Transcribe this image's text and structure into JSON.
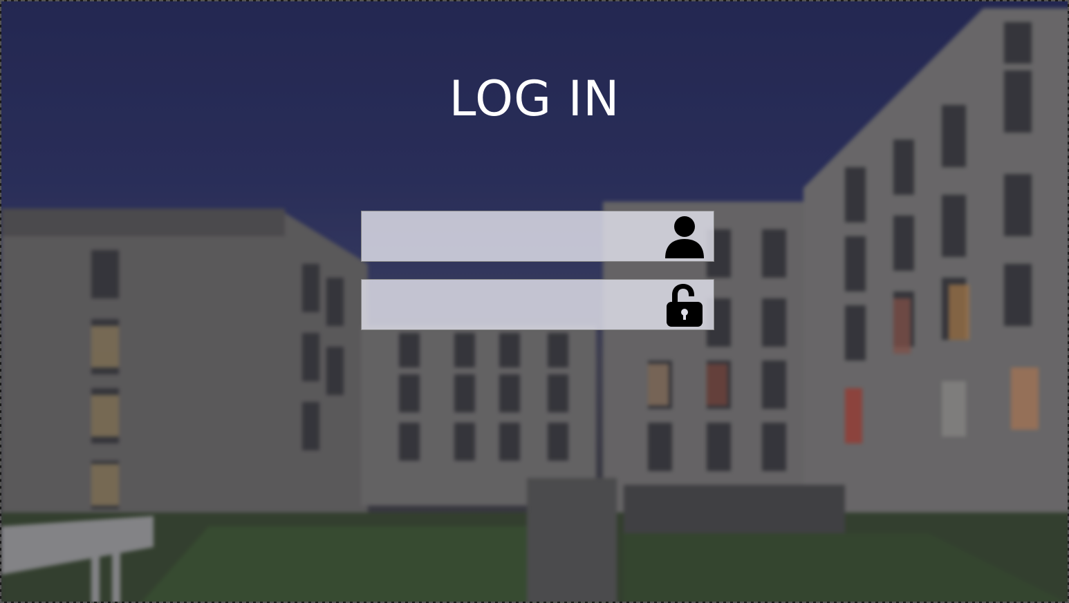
{
  "login": {
    "title": "LOG IN",
    "username": {
      "value": "",
      "placeholder": "",
      "icon": "user-icon"
    },
    "password": {
      "value": "",
      "placeholder": "",
      "icon": "unlocked-padlock-icon"
    }
  },
  "colors": {
    "title_text": "#ffffff",
    "field_background": "#dcdce6",
    "icon": "#000000"
  }
}
